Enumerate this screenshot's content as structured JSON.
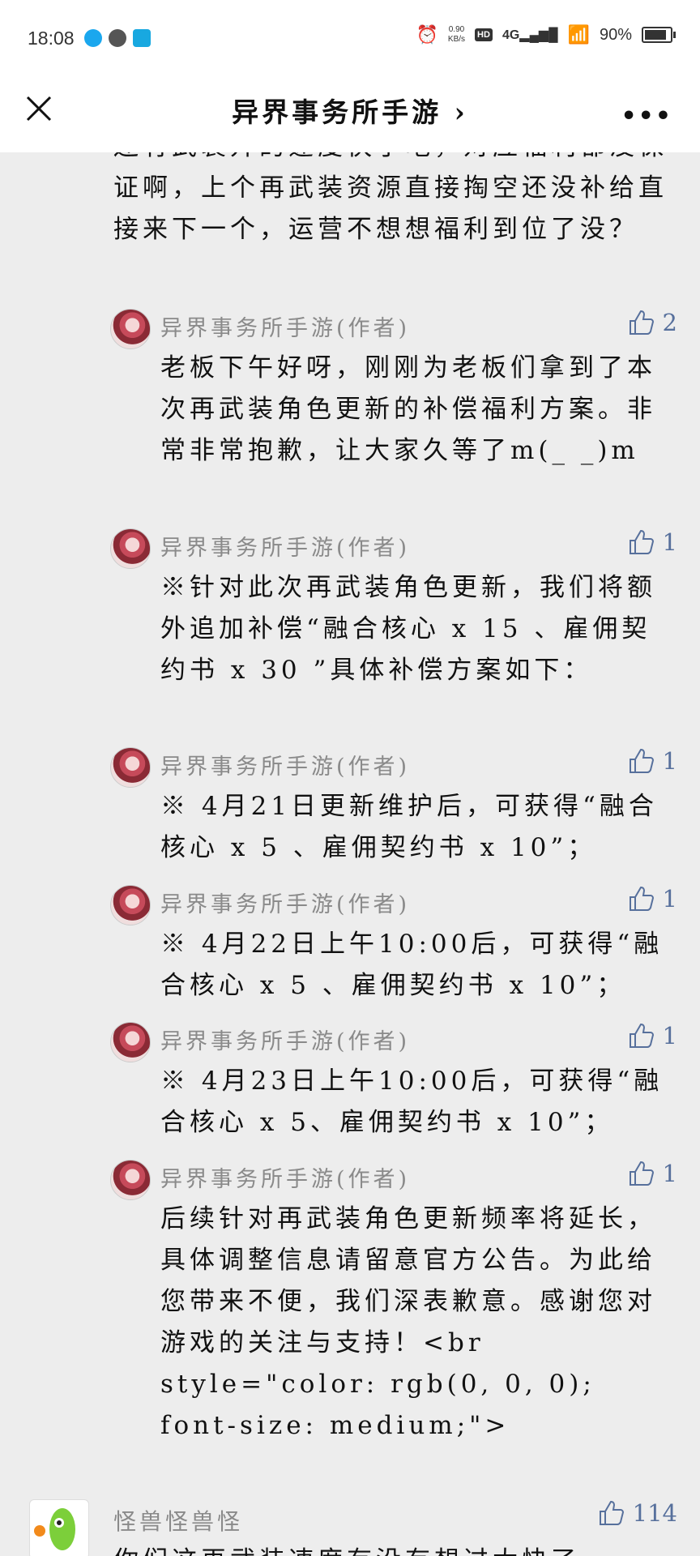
{
  "status_bar": {
    "time": "18:08",
    "speed_value": "0.90",
    "speed_unit": "KB/s",
    "hd": "HD",
    "network": "4G",
    "battery": "90%"
  },
  "nav": {
    "title": "异界事务所手游 ›"
  },
  "top_comment": {
    "text": "还有武装升的速度快了吧，对应福利都没保证啊，上个再武装资源直接掏空还没补给直接来下一个，运营不想想福利到位了没？"
  },
  "replies": [
    {
      "author": "异界事务所手游(作者)",
      "likes": "2",
      "text": "老板下午好呀，刚刚为老板们拿到了本次再武装角色更新的补偿福利方案。非常非常抱歉，让大家久等了m(_ _)m"
    },
    {
      "author": "异界事务所手游(作者)",
      "likes": "1",
      "text": "※针对此次再武装角色更新，我们将额外追加补偿“融合核心 x 15 、雇佣契约书 x 30 ”具体补偿方案如下："
    },
    {
      "author": "异界事务所手游(作者)",
      "likes": "1",
      "text": "※ 4月21日更新维护后，可获得“融合核心 x 5 、雇佣契约书 x 10”；"
    },
    {
      "author": "异界事务所手游(作者)",
      "likes": "1",
      "text": "※ 4月22日上午10:00后，可获得“融合核心 x 5 、雇佣契约书 x 10”；"
    },
    {
      "author": "异界事务所手游(作者)",
      "likes": "1",
      "text": "※ 4月23日上午10:00后，可获得“融合核心 x 5、雇佣契约书 x 10”；"
    },
    {
      "author": "异界事务所手游(作者)",
      "likes": "1",
      "text": "后续针对再武装角色更新频率将延长，具体调整信息请留意官方公告。为此给您带来不便，我们深表歉意。感谢您对游戏的关注与支持！<br style=\"color: rgb(0, 0, 0); font-size: medium;\">"
    }
  ],
  "next_comment": {
    "author": "怪兽怪兽怪",
    "likes": "114",
    "text": "你们这再武装速度有没有想过太快了..."
  }
}
